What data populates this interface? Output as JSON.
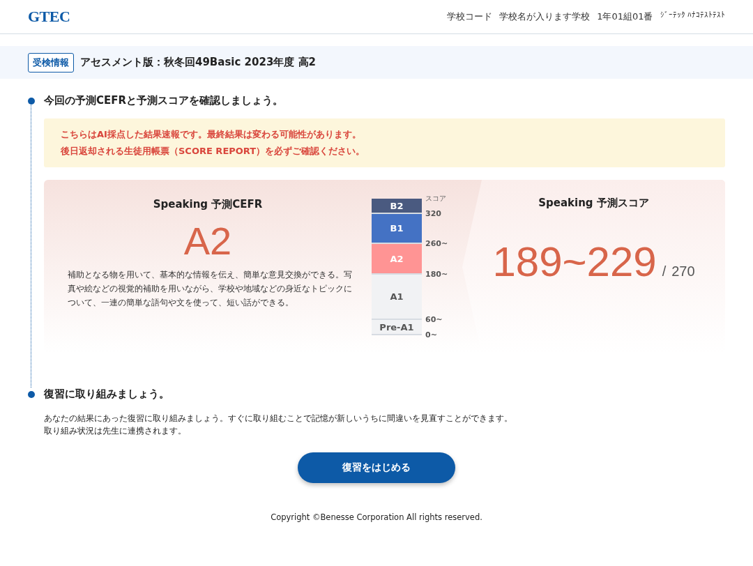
{
  "header": {
    "logo": "GTEC",
    "user_info": [
      "学校コード",
      "学校名が入ります学校",
      "1年01組01番",
      "ｼﾞｰﾃｯｸ ﾊﾅｺﾃｽﾄﾃｽﾄ"
    ]
  },
  "exam": {
    "badge": "受検情報",
    "title": "アセスメント版：秋冬回49Basic 2023年度 高2"
  },
  "section_1": {
    "heading": "今回の予測CEFRと予測スコアを確認しましょう。",
    "notice": [
      "こちらはAI採点した結果速報です。最終結果は変わる可能性があります。",
      "後日返却される生徒用帳票（SCORE REPORT）を必ずご確認ください。"
    ],
    "cefr": {
      "title": "Speaking 予測CEFR",
      "level": "A2",
      "description": "補助となる物を用いて、基本的な情報を伝え、簡単な意見交換ができる。写真や絵などの視覚的補助を用いながら、学校や地域などの身近なトピックについて、一連の簡単な語句や文を使って、短い話ができる。"
    },
    "scale": {
      "heading": "スコア",
      "bands": [
        {
          "label": "B2",
          "color": "#4a5a80",
          "tick": "320"
        },
        {
          "label": "B1",
          "color": "#4472c4",
          "tick": "260~"
        },
        {
          "label": "A2",
          "color": "#ff9494",
          "tick": "180~"
        },
        {
          "label": "A1",
          "color": "#f1f2f4",
          "tick": "60~"
        },
        {
          "label": "Pre-A1",
          "color": "#f1f2f4",
          "tick": "0~"
        }
      ]
    },
    "score": {
      "title": "Speaking 予測スコア",
      "range": "189~229",
      "separator": "/",
      "max": "270"
    }
  },
  "section_2": {
    "heading": "復習に取り組みましょう。",
    "text": [
      "あなたの結果にあった復習に取り組みましょう。すぐに取り組むことで記憶が新しいうちに間違いを見直すことができます。",
      "取り組み状況は先生に連携されます。"
    ],
    "button": "復習をはじめる"
  },
  "footer": "Copyright ©Benesse Corporation All rights reserved."
}
